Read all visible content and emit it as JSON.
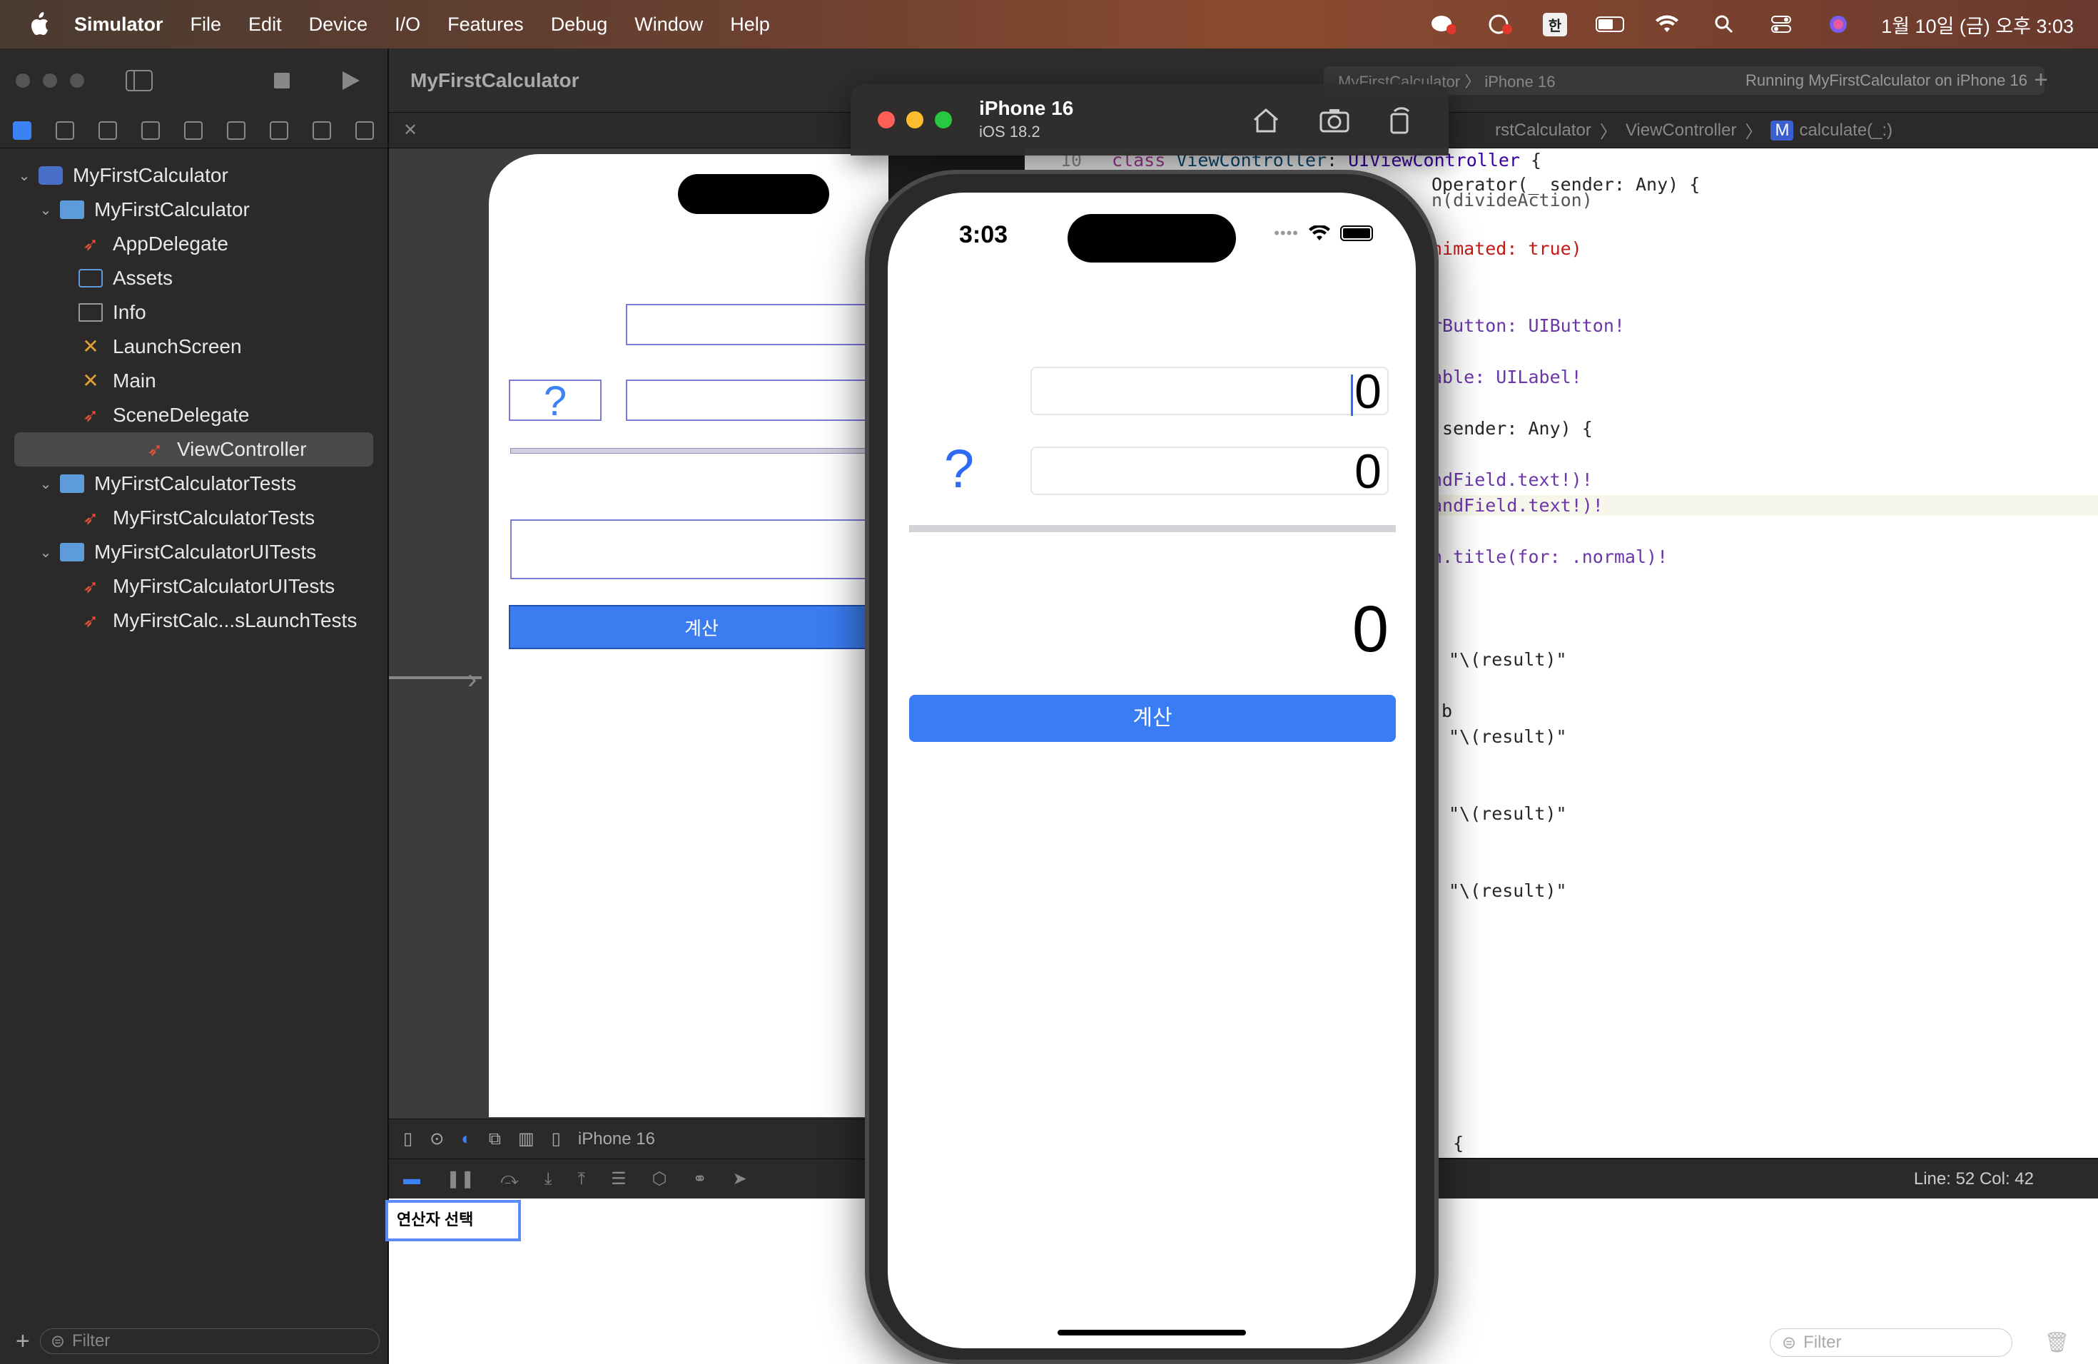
{
  "menubar": {
    "app_name": "Simulator",
    "items": [
      "File",
      "Edit",
      "Device",
      "I/O",
      "Features",
      "Debug",
      "Window",
      "Help"
    ],
    "input_method": "한",
    "clock": "1월 10일 (금) 오후 3:03"
  },
  "xcode": {
    "project_title": "MyFirstCalculator",
    "status_text": "MyFirstCalculator 〉 iPhone 16",
    "run_status": "Running MyFirstCalculator on iPhone 16",
    "jump_path": [
      "rstCalculator",
      "ViewController",
      "calculate(_:)"
    ],
    "tree": [
      {
        "label": "MyFirstCalculator",
        "level": 0,
        "type": "project"
      },
      {
        "label": "MyFirstCalculator",
        "level": 1,
        "type": "folder"
      },
      {
        "label": "AppDelegate",
        "level": 2,
        "type": "swift"
      },
      {
        "label": "Assets",
        "level": 2,
        "type": "assets"
      },
      {
        "label": "Info",
        "level": 2,
        "type": "plist"
      },
      {
        "label": "LaunchScreen",
        "level": 2,
        "type": "storyboard"
      },
      {
        "label": "Main",
        "level": 2,
        "type": "storyboard"
      },
      {
        "label": "SceneDelegate",
        "level": 2,
        "type": "swift"
      },
      {
        "label": "ViewController",
        "level": 2,
        "type": "swift",
        "selected": true
      },
      {
        "label": "MyFirstCalculatorTests",
        "level": 1,
        "type": "folder"
      },
      {
        "label": "MyFirstCalculatorTests",
        "level": 2,
        "type": "swift"
      },
      {
        "label": "MyFirstCalculatorUITests",
        "level": 1,
        "type": "folder"
      },
      {
        "label": "MyFirstCalculatorUITests",
        "level": 2,
        "type": "swift"
      },
      {
        "label": "MyFirstCalc...sLaunchTests",
        "level": 2,
        "type": "swift"
      }
    ],
    "nav_filter_placeholder": "Filter",
    "console_filter_placeholder": "Filter",
    "ib_device_label": "iPhone 16",
    "ib_question": "?",
    "ib_button_label": "계산",
    "line_col": "Line: 52  Col: 42",
    "tooltip_text": "연산자 선택"
  },
  "code_lines": {
    "l10_num": "10",
    "l10": "class ViewController: UIViewController {",
    "l11": "Operator(_ sender: Any) {",
    "l12": "n(divideAction)",
    "l13": "nimated: true)",
    "l14": "rButton: UIButton!",
    "l15": "able: UILabel!",
    "l16": " sender: Any) {",
    "l17": "ndField.text!)!",
    "l18": "andField.text!)!",
    "l19": "n.title(for: .normal)!",
    "l20": "\"\\(result)\"",
    "l21": "b",
    "l22": "\"\\(result)\"",
    "l23": "\"\\(result)\"",
    "l24": "\"\\(result)\"",
    "l25": ") {"
  },
  "simulator": {
    "device_name": "iPhone 16",
    "os_version": "iOS 18.2",
    "status_time": "3:03",
    "first_operand": "0",
    "operator_label": "?",
    "second_operand": "0",
    "result": "0",
    "calculate_button": "계산"
  }
}
